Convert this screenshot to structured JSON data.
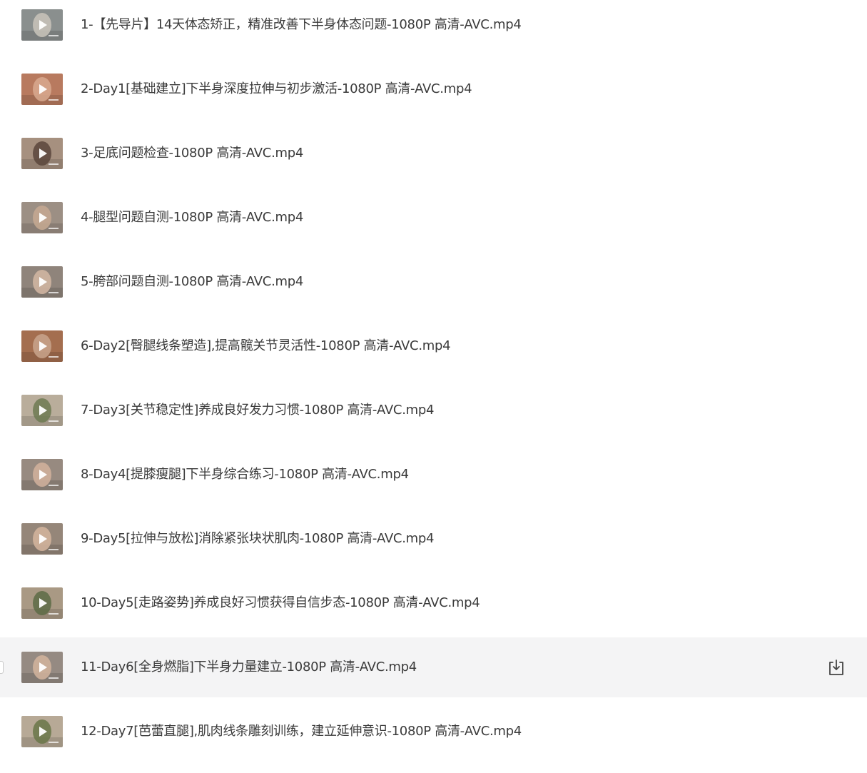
{
  "files": [
    {
      "name": "1-【先导片】14天体态矫正，精准改善下半身体态问题-1080P 高清-AVC.mp4",
      "thumb_bg": "#8a8f8e",
      "thumb_fg": "#c9c4bb"
    },
    {
      "name": "2-Day1[基础建立]下半身深度拉伸与初步激活-1080P 高清-AVC.mp4",
      "thumb_bg": "#b87a5f",
      "thumb_fg": "#d8a98f"
    },
    {
      "name": "3-足底问题检查-1080P 高清-AVC.mp4",
      "thumb_bg": "#a6907f",
      "thumb_fg": "#5b463c"
    },
    {
      "name": "4-腿型问题自测-1080P 高清-AVC.mp4",
      "thumb_bg": "#9c8f84",
      "thumb_fg": "#c7a992"
    },
    {
      "name": "5-胯部问题自测-1080P 高清-AVC.mp4",
      "thumb_bg": "#8f847b",
      "thumb_fg": "#d3b7a3"
    },
    {
      "name": "6-Day2[臀腿线条塑造],提高髋关节灵活性-1080P 高清-AVC.mp4",
      "thumb_bg": "#a46e4f",
      "thumb_fg": "#c9a58c"
    },
    {
      "name": "7-Day3[关节稳定性]养成良好发力习惯-1080P 高清-AVC.mp4",
      "thumb_bg": "#b9ad9b",
      "thumb_fg": "#6d7a52"
    },
    {
      "name": "8-Day4[提膝瘦腿]下半身综合练习-1080P 高清-AVC.mp4",
      "thumb_bg": "#978a80",
      "thumb_fg": "#d2b29c"
    },
    {
      "name": "9-Day5[拉伸与放松]消除紧张块状肌肉-1080P 高清-AVC.mp4",
      "thumb_bg": "#958679",
      "thumb_fg": "#d5b59d"
    },
    {
      "name": "10-Day5[走路姿势]养成良好习惯获得自信步态-1080P 高清-AVC.mp4",
      "thumb_bg": "#a99984",
      "thumb_fg": "#5d6b45"
    },
    {
      "name": "11-Day6[全身燃脂]下半身力量建立-1080P 高清-AVC.mp4",
      "thumb_bg": "#958a82",
      "thumb_fg": "#d4b49e",
      "hovered": true
    },
    {
      "name": "12-Day7[芭蕾直腿],肌肉线条雕刻训练，建立延伸意识-1080P 高清-AVC.mp4",
      "thumb_bg": "#b7a996",
      "thumb_fg": "#6a7749"
    }
  ],
  "icons": {
    "thumbnail_overlay": "play-icon",
    "row_action": "download-icon"
  },
  "colors": {
    "text": "#3a3a3a",
    "hover_bg": "#f4f4f5",
    "icon": "#444444"
  }
}
